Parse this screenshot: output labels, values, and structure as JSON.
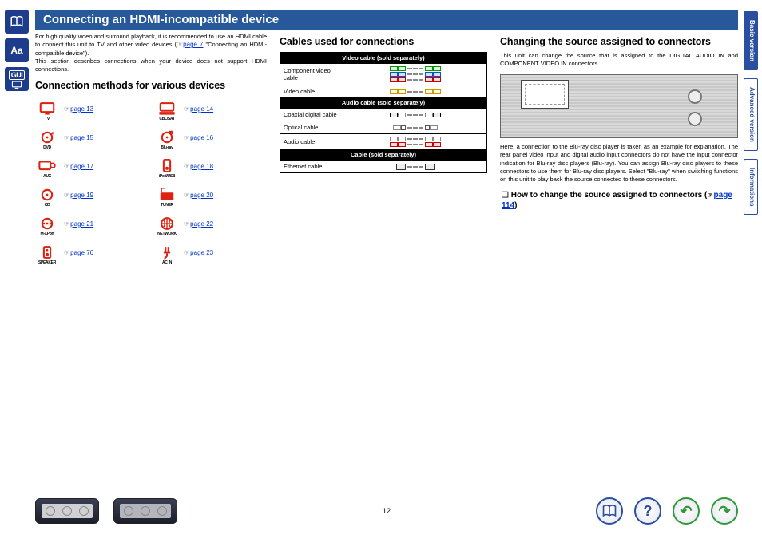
{
  "banner": {
    "title": "Connecting an HDMI-incompatible device"
  },
  "intro": {
    "line1": "For high quality video and surround playback, it is recommended to use an HDMI cable to connect this unit to TV and other video devices (",
    "link_label": "page 7",
    "line1b": " \"Connecting an HDMI-compatible device\").",
    "line2": "This section describes connections when your device does not support HDMI connections."
  },
  "col1": {
    "heading": "Connection methods for various devices",
    "devices": [
      {
        "icon": "tv",
        "label": "TV",
        "page": "page 13"
      },
      {
        "icon": "cbl",
        "label": "CBL/SAT",
        "page": "page 14"
      },
      {
        "icon": "dvd",
        "label": "DVD",
        "page": "page 15"
      },
      {
        "icon": "bluray",
        "label": "Blu-ray",
        "page": "page 16"
      },
      {
        "icon": "aux",
        "label": "AUX",
        "page": "page 17"
      },
      {
        "icon": "ipod",
        "label": "iPod/USB",
        "page": "page 18"
      },
      {
        "icon": "cd",
        "label": "CD",
        "page": "page 19"
      },
      {
        "icon": "tuner",
        "label": "TUNER",
        "page": "page 20"
      },
      {
        "icon": "mxport",
        "label": "M-XPort",
        "page": "page 21"
      },
      {
        "icon": "network",
        "label": "NETWORK",
        "page": "page 22"
      },
      {
        "icon": "speaker",
        "label": "SPEAKER",
        "page": "page 76"
      },
      {
        "icon": "acin",
        "label": "AC IN",
        "page": "page 23"
      }
    ]
  },
  "col2": {
    "heading": "Cables used for connections",
    "sections": [
      {
        "header": "Video cable (sold separately)",
        "rows": [
          {
            "name": "Component video cable",
            "vis": "component"
          },
          {
            "name": "Video cable",
            "vis": "video"
          }
        ]
      },
      {
        "header": "Audio cable (sold separately)",
        "rows": [
          {
            "name": "Coaxial digital cable",
            "vis": "coax"
          },
          {
            "name": "Optical cable",
            "vis": "optical"
          },
          {
            "name": "Audio cable",
            "vis": "audio"
          }
        ]
      },
      {
        "header": "Cable (sold separately)",
        "rows": [
          {
            "name": "Ethernet cable",
            "vis": "ethernet"
          }
        ]
      }
    ]
  },
  "col3": {
    "heading": "Changing the source assigned to connectors",
    "p1": "This unit can change the source that is assigned to the DIGITAL AUDIO IN and COMPONENT VIDEO IN connectors.",
    "p2": "Here, a connection to the Blu-ray disc player is taken as an example for explanation. The rear panel video input and digital audio input connectors do not have the input connector indication for Blu-ray disc players (Blu-ray). You can assign Blu-ray disc players to these connectors to use them for Blu-ray disc players. Select \"Blu-ray\" when switching functions on this unit to play back the source connected to these connectors.",
    "sub_heading_a": "How to change the source assigned to connectors (",
    "sub_link": "page 114",
    "sub_heading_b": ")"
  },
  "tabs": {
    "basic": "Basic version",
    "advanced": "Advanced version",
    "info": "Informations"
  },
  "footer": {
    "page_number": "12"
  }
}
